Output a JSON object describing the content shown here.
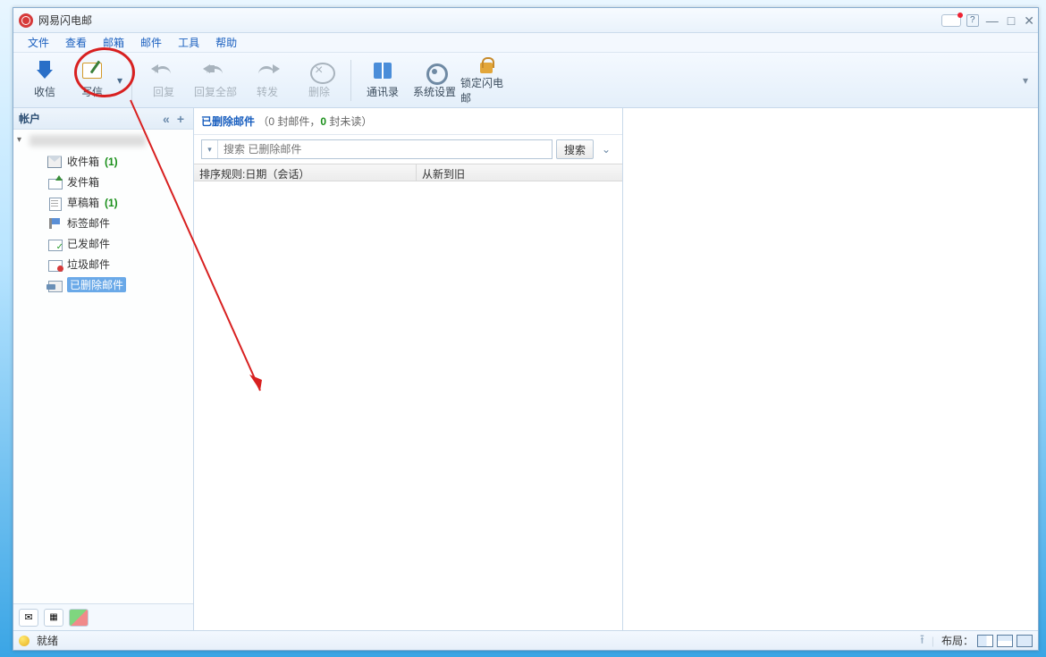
{
  "app": {
    "title": "网易闪电邮"
  },
  "window_controls": {
    "minimize": "—",
    "maximize": "□",
    "close": "✕",
    "help": "?"
  },
  "menu": [
    "文件",
    "查看",
    "邮箱",
    "邮件",
    "工具",
    "帮助"
  ],
  "toolbar": {
    "receive": "收信",
    "compose": "写信",
    "reply": "回复",
    "reply_all": "回复全部",
    "forward": "转发",
    "delete": "删除",
    "contacts": "通讯录",
    "settings": "系统设置",
    "lock": "锁定闪电邮"
  },
  "sidebar": {
    "header": "帐户",
    "add": "+",
    "collapse": "«",
    "folders": [
      {
        "id": "inbox",
        "label": "收件箱",
        "count": "(1)"
      },
      {
        "id": "outbox",
        "label": "发件箱"
      },
      {
        "id": "drafts",
        "label": "草稿箱",
        "count": "(1)"
      },
      {
        "id": "tagged",
        "label": "标签邮件"
      },
      {
        "id": "sent",
        "label": "已发邮件"
      },
      {
        "id": "spam",
        "label": "垃圾邮件"
      },
      {
        "id": "deleted",
        "label": "已删除邮件",
        "selected": true
      }
    ]
  },
  "list": {
    "title": "已删除邮件",
    "summary_open": "（",
    "summary_mail": "0 封邮件，",
    "summary_unread_n": "0",
    "summary_unread_t": " 封未读",
    "summary_close": "）",
    "search_placeholder": "搜索 已删除邮件",
    "search_btn": "搜索",
    "sort_rule": "排序规则:日期（会话）",
    "sort_order": "从新到旧"
  },
  "status": {
    "text": "就绪",
    "layout_label": "布局："
  }
}
